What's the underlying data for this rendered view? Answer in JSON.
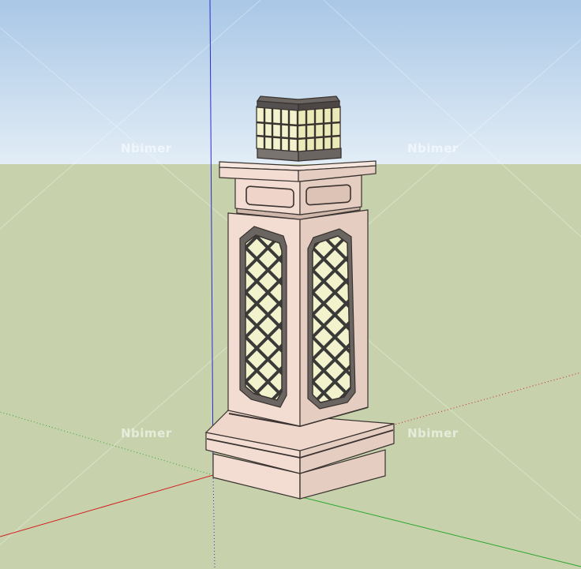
{
  "watermarks": [
    "Nbimer",
    "Nbimer",
    "Nbimer",
    "Nbimer"
  ],
  "colors": {
    "sky_top": "#a9c7e6",
    "sky_bottom": "#e2edf6",
    "ground": "#c7d2ad",
    "axis_red": "#d21e1e",
    "axis_green": "#2aa52a",
    "axis_blue": "#2b2bd6",
    "stone_front": "#f3ddd2",
    "stone_side": "#e5cdc1",
    "glass": "#f2f3cc"
  }
}
